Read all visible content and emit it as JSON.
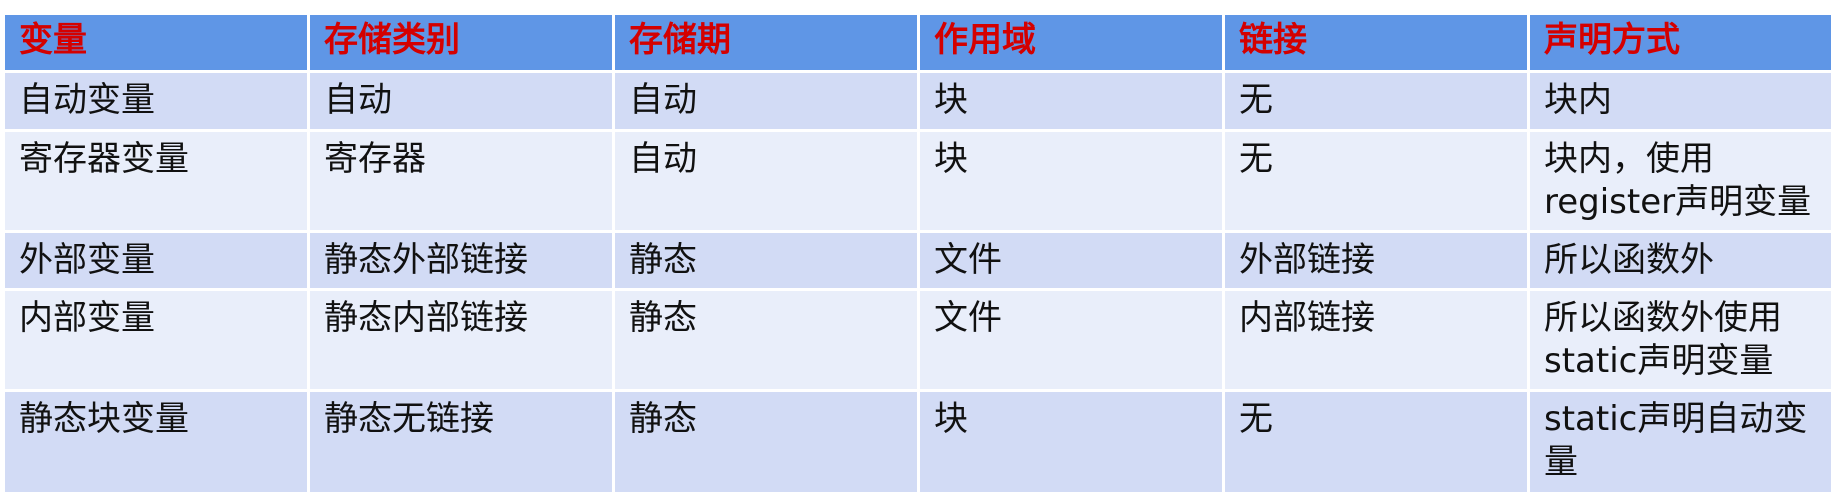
{
  "table": {
    "headers": [
      "变量",
      "存储类别",
      "存储期",
      "作用域",
      "链接",
      "声明方式"
    ],
    "rows": [
      [
        "自动变量",
        "自动",
        "自动",
        "块",
        "无",
        "块内"
      ],
      [
        "寄存器变量",
        "寄存器",
        "自动",
        "块",
        "无",
        "块内，使用register声明变量"
      ],
      [
        "外部变量",
        "静态外部链接",
        "静态",
        "文件",
        "外部链接",
        "所以函数外"
      ],
      [
        "内部变量",
        "静态内部链接",
        "静态",
        "文件",
        "内部链接",
        "所以函数外使用static声明变量"
      ],
      [
        "静态块变量",
        "静态无链接",
        "静态",
        "块",
        "无",
        "static声明自动变量"
      ]
    ]
  },
  "colors": {
    "header_background": "#5f96e6",
    "header_text": "#d40000",
    "row_band_dark": "#d2dbf5",
    "row_band_light": "#e9eefa",
    "cell_text": "#111111"
  }
}
